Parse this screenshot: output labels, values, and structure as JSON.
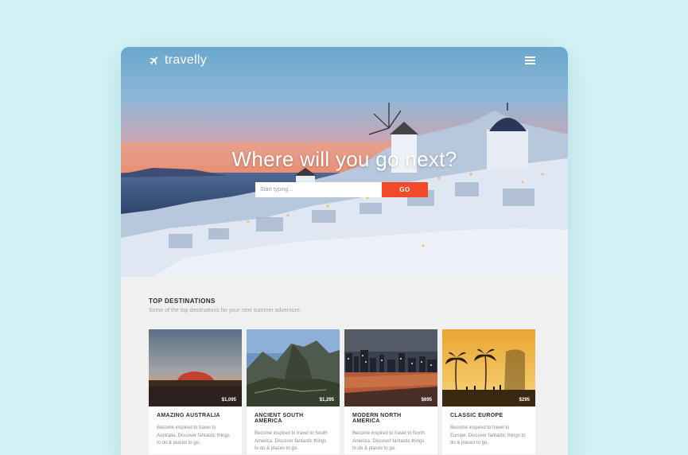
{
  "header": {
    "brand": "travelly",
    "logo_icon": "airplane-icon",
    "menu_icon": "hamburger-menu-icon"
  },
  "hero": {
    "headline": "Where will you go next?",
    "search_placeholder": "Start typing...",
    "search_button": "GO"
  },
  "destinations": {
    "title": "TOP DESTINATIONS",
    "subtitle": "Some of the top destinations for your next summer adventure.",
    "cards": [
      {
        "name": "AMAZING AUSTRALIA",
        "price": "$1,095",
        "desc": "Become inspired to travel to Australia. Discover fantastic things to do & places to go."
      },
      {
        "name": "ANCIENT SOUTH AMERICA",
        "price": "$1,295",
        "desc": "Become inspired to travel to South America. Discover fantastic things to do & places to go."
      },
      {
        "name": "MODERN NORTH AMERICA",
        "price": "$695",
        "desc": "Become inspired to travel to North America. Discover fantastic things to do & places to go."
      },
      {
        "name": "CLASSIC EUROPE",
        "price": "$295",
        "desc": "Become inspired to travel to Europe. Discover fantastic things to do & places to go."
      }
    ]
  },
  "colors": {
    "page_bg": "#d5f3f6",
    "accent": "#f2492a"
  }
}
